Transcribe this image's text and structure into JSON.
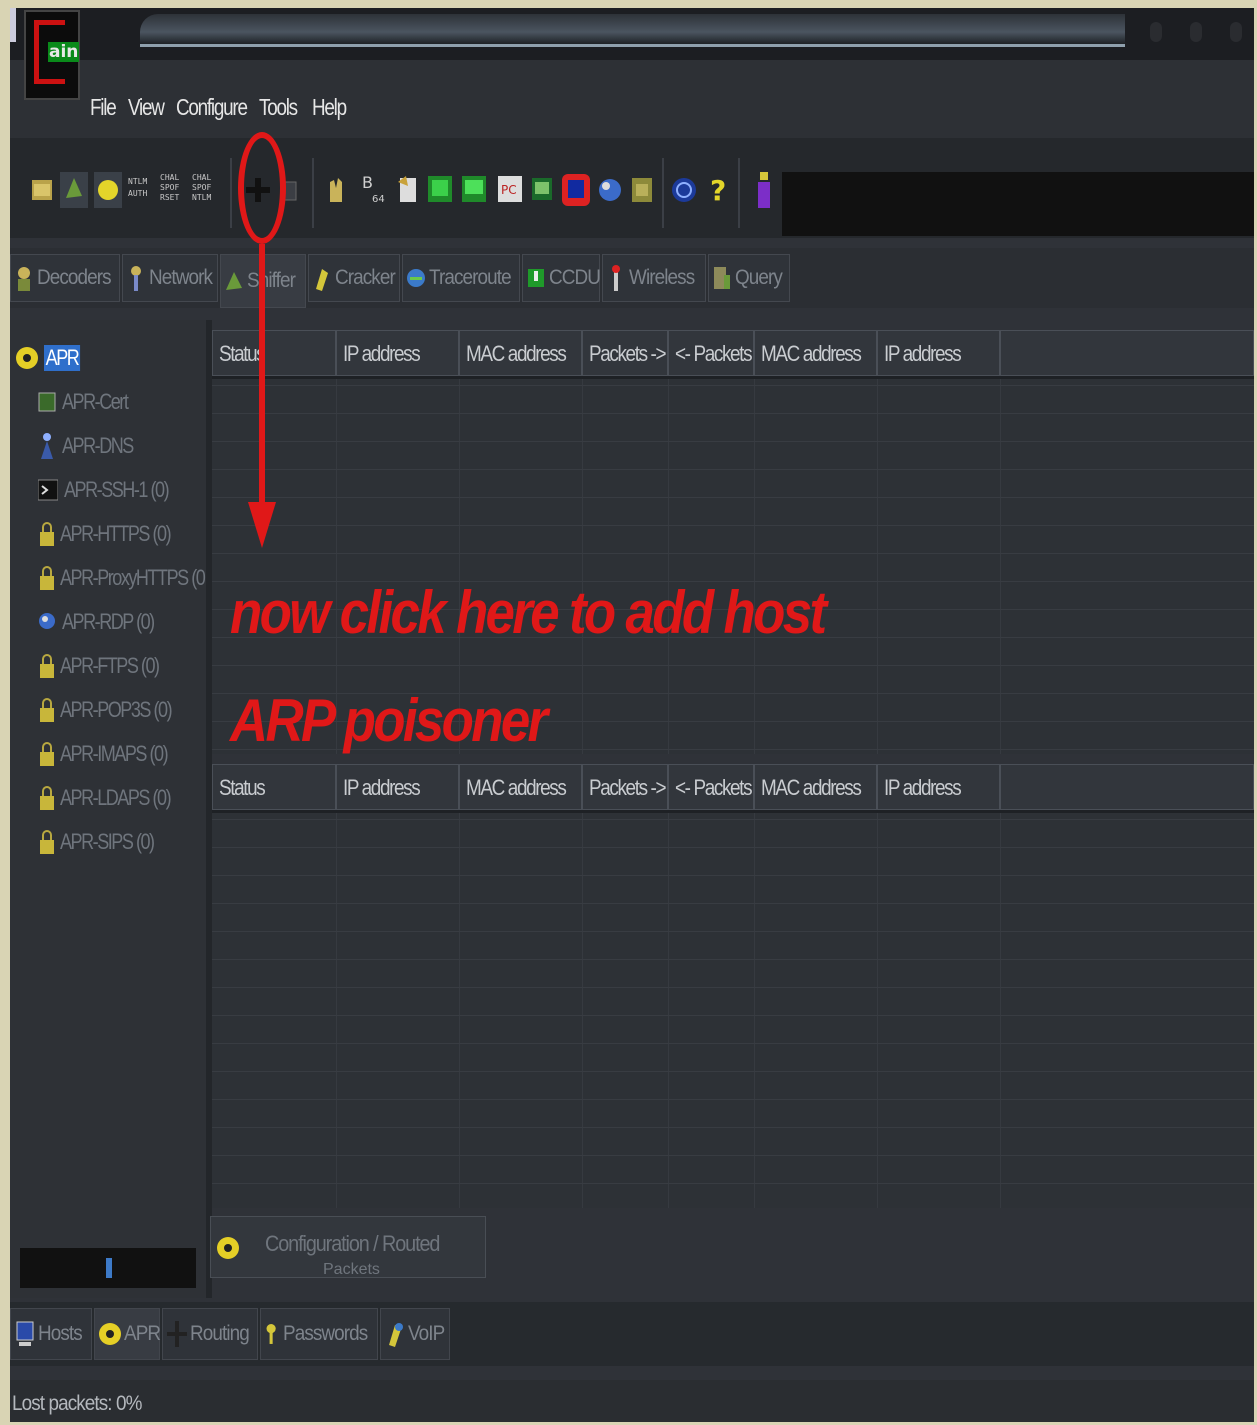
{
  "app": {
    "logo_text": "ain"
  },
  "menu": [
    "File",
    "View",
    "Configure",
    "Tools",
    "Help"
  ],
  "toolbar": {
    "labels": {
      "ntlm_auth": "NTLM AUTH",
      "chall_spoof_reset": "CHALL SPOOF RESET",
      "chall_spoof_ntlm": "CHALL SPOOF NTLM",
      "base64": "B 64"
    }
  },
  "tabs": [
    "Decoders",
    "Network",
    "Sniffer",
    "Cracker",
    "Traceroute",
    "CCDU",
    "Wireless",
    "Query"
  ],
  "active_tab": "Sniffer",
  "tree": {
    "root": "APR",
    "items": [
      "APR-Cert",
      "APR-DNS",
      "APR-SSH-1 (0)",
      "APR-HTTPS (0)",
      "APR-ProxyHTTPS (0",
      "APR-RDP (0)",
      "APR-FTPS (0)",
      "APR-POP3S (0)",
      "APR-IMAPS (0)",
      "APR-LDAPS (0)",
      "APR-SIPS (0)"
    ]
  },
  "grid_top": {
    "columns": [
      "Status",
      "IP address",
      "MAC address",
      "Packets ->",
      "<- Packets",
      "MAC address",
      "IP address"
    ]
  },
  "grid_bottom": {
    "columns": [
      "Status",
      "IP address",
      "MAC address",
      "Packets ->",
      "<- Packets",
      "MAC address",
      "IP address"
    ]
  },
  "annotation": {
    "line1": "now click here to add host",
    "line2": "ARP poisoner",
    "color": "#e01818"
  },
  "config_box": {
    "line1": "Configuration / Routed",
    "line2": "Packets"
  },
  "bottom_tabs": [
    "Hosts",
    "APR",
    "Routing",
    "Passwords",
    "VoIP"
  ],
  "active_bottom_tab": "APR",
  "status": {
    "text": "Lost packets:  0%"
  }
}
